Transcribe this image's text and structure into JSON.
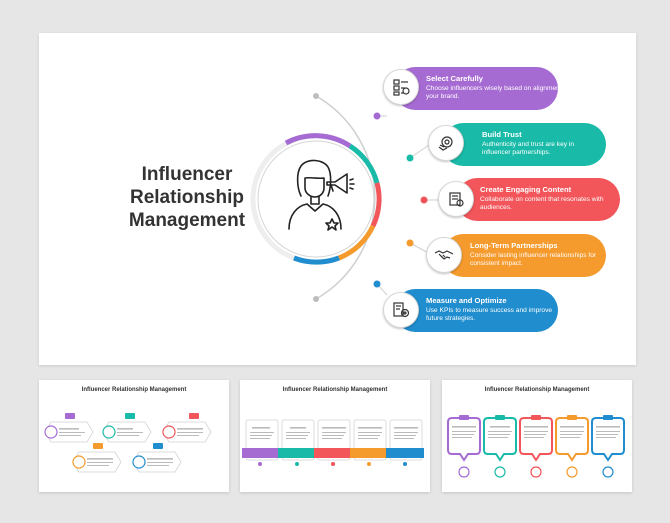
{
  "main": {
    "title": "Influencer Relationship Management",
    "items": [
      {
        "title": "Select Carefully",
        "desc": "Choose influencers wisely based on alignment with your brand.",
        "color": "#a66bd3",
        "icon": "checklist-icon"
      },
      {
        "title": "Build Trust",
        "desc": "Authenticity and trust are key in influencer partnerships.",
        "color": "#19bba8",
        "icon": "handshake-gear-icon"
      },
      {
        "title": "Create Engaging Content",
        "desc": "Collaborate on content that resonates with audiences.",
        "color": "#f2555a",
        "icon": "content-icon"
      },
      {
        "title": "Long-Term Partnerships",
        "desc": "Consider lasting influencer relationships for consistent impact.",
        "color": "#f59a2c",
        "icon": "handshake-icon"
      },
      {
        "title": "Measure and Optimize",
        "desc": "Use KPIs to measure success and improve future strategies.",
        "color": "#1f8dce",
        "icon": "kpi-gear-icon"
      }
    ]
  },
  "thumbs": [
    {
      "title": "Influencer Relationship Management"
    },
    {
      "title": "Influencer Relationship Management"
    },
    {
      "title": "Influencer Relationship Management"
    }
  ]
}
